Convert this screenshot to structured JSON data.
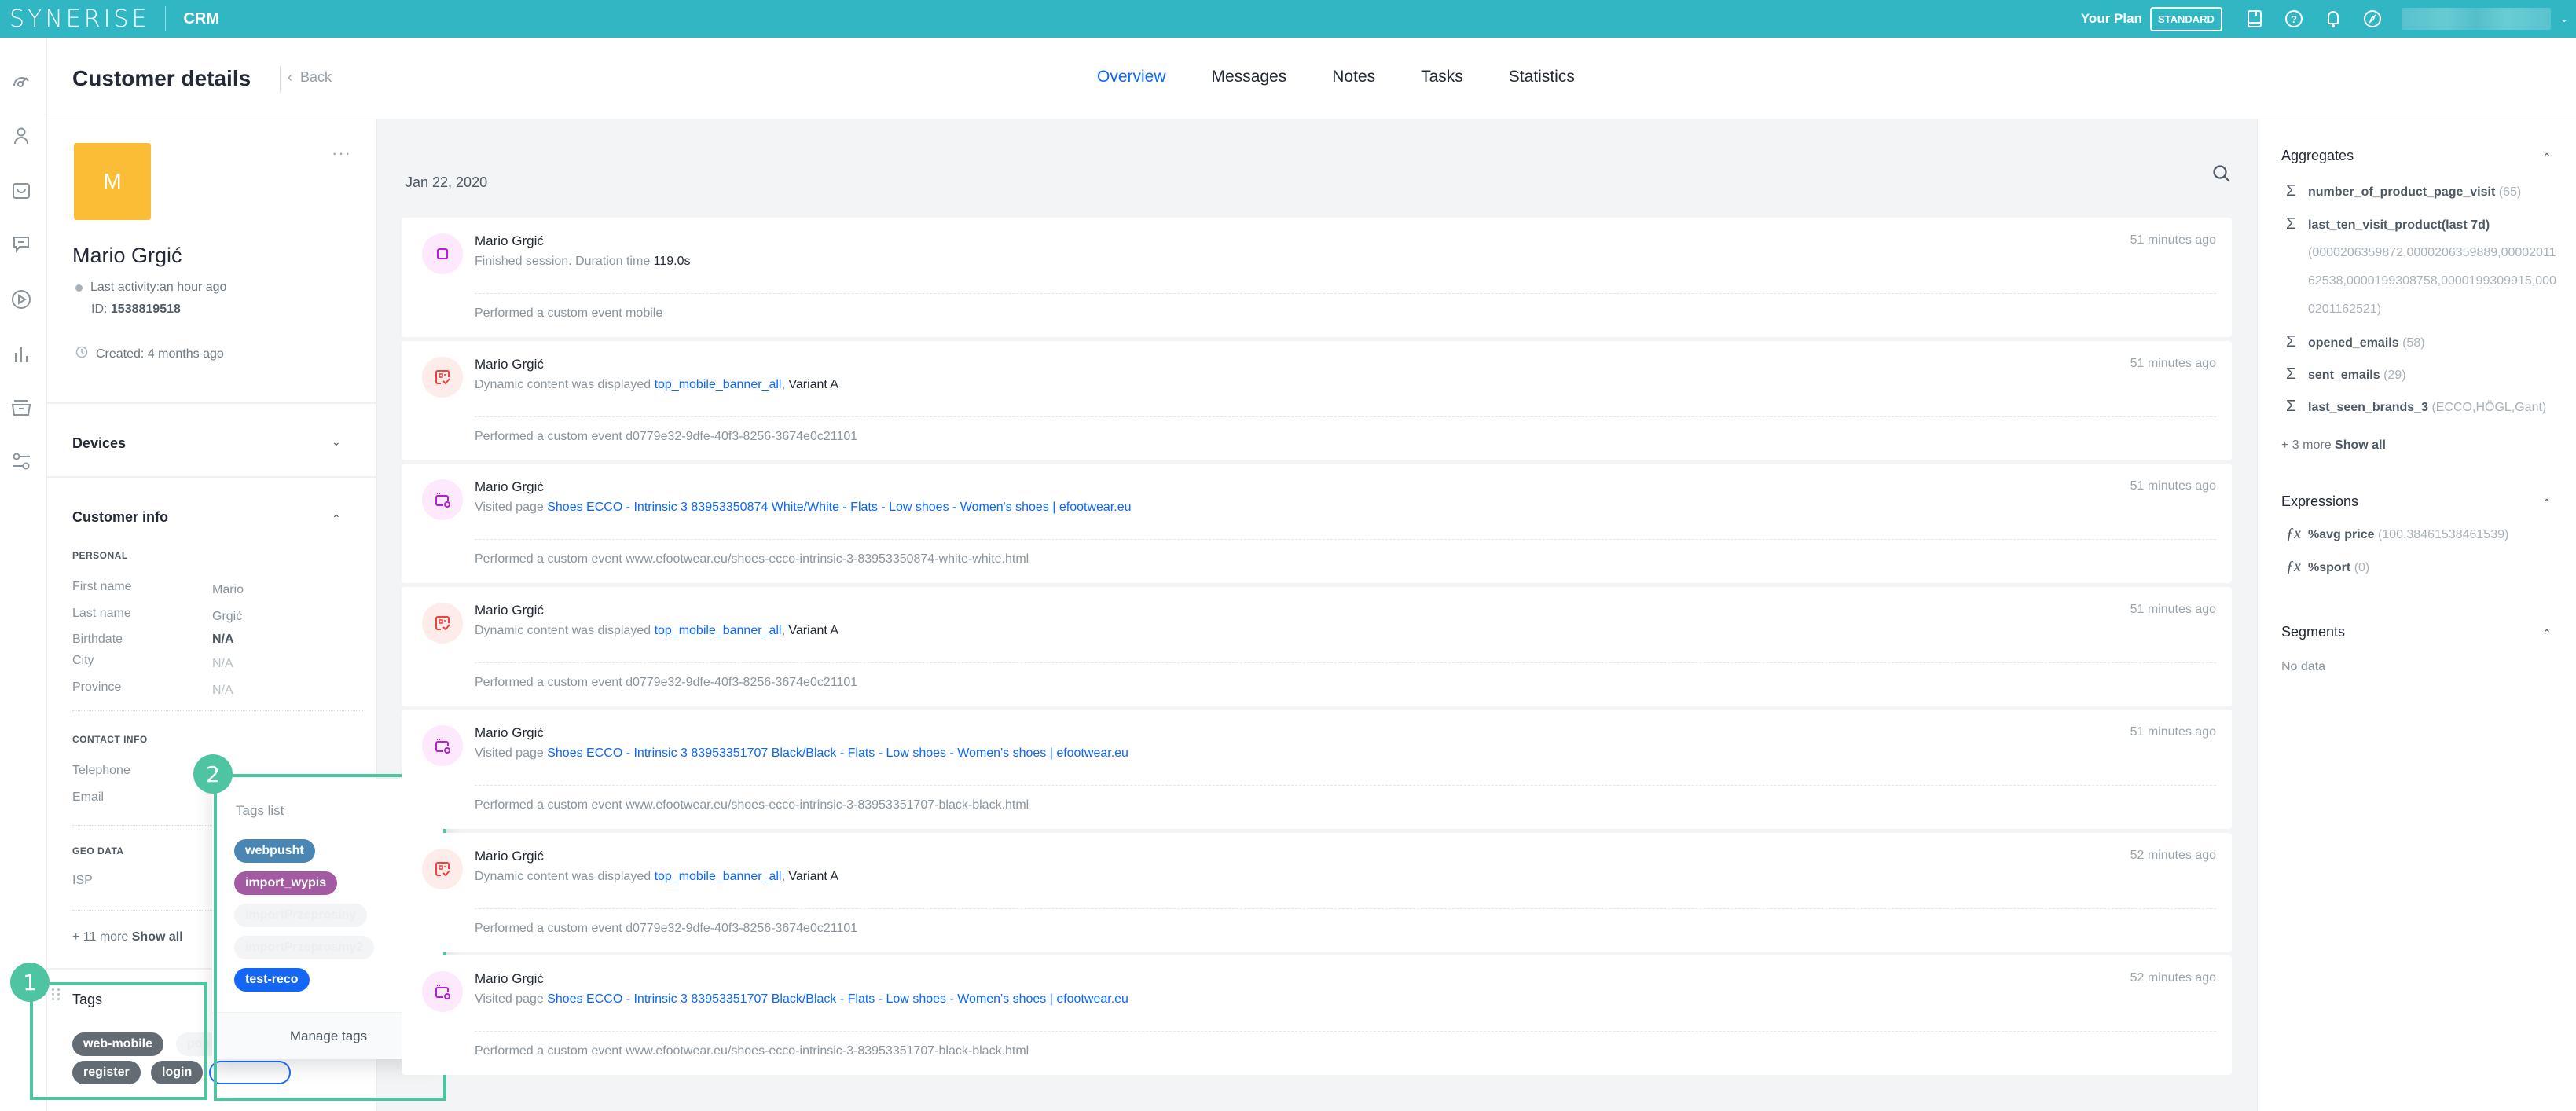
{
  "topbar": {
    "logo": "SYNERISE",
    "app_name": "CRM",
    "plan_label": "Your Plan",
    "plan_badge": "STANDARD",
    "icons": [
      "book-icon",
      "help-icon",
      "bell-icon",
      "compass-icon"
    ]
  },
  "rail": {
    "items": [
      "dashboard-icon",
      "profile-icon",
      "bag-icon",
      "chat-icon",
      "play-icon",
      "analytics-icon",
      "inbox-icon",
      "settings-sliders-icon"
    ]
  },
  "header": {
    "title": "Customer details",
    "back_label": "Back",
    "tabs": [
      {
        "label": "Overview",
        "active": true
      },
      {
        "label": "Messages",
        "active": false
      },
      {
        "label": "Notes",
        "active": false
      },
      {
        "label": "Tasks",
        "active": false
      },
      {
        "label": "Statistics",
        "active": false
      }
    ]
  },
  "customer": {
    "avatar_initial": "M",
    "avatar_color": "#fbbd36",
    "name": "Mario Grgić",
    "last_activity": "Last activity:an hour ago",
    "id_label": "ID:",
    "id_value": "1538819518",
    "created": "Created: 4 months ago",
    "more_menu": "···"
  },
  "devices": {
    "title": "Devices"
  },
  "customer_info": {
    "title": "Customer info",
    "personal": {
      "label": "PERSONAL",
      "fields": [
        {
          "label": "First name",
          "value": "Mario"
        },
        {
          "label": "Last name",
          "value": "Grgić"
        },
        {
          "label": "Birthdate",
          "value": "N/A"
        },
        {
          "label": "City",
          "value": "N/A"
        },
        {
          "label": "Province",
          "value": "N/A"
        }
      ]
    },
    "contact": {
      "label": "CONTACT INFO",
      "fields": [
        {
          "label": "Telephone",
          "value": ""
        },
        {
          "label": "Email",
          "value": ""
        }
      ]
    },
    "geo": {
      "label": "GEO DATA",
      "fields": [
        {
          "label": "ISP",
          "value": ""
        }
      ]
    },
    "more_prefix": "+ 11 more",
    "show_all": "Show all"
  },
  "tags": {
    "title": "Tags",
    "assigned": [
      "web-mobile",
      "pop",
      "register",
      "login"
    ],
    "input_value": ""
  },
  "tags_popup": {
    "title": "Tags list",
    "tags": [
      {
        "label": "webpusht",
        "color": "#4a86b4"
      },
      {
        "label": "import_wypis",
        "color": "#a35aa3"
      },
      {
        "label": "importPrzeprosiny",
        "color": "#f3f4f5"
      },
      {
        "label": "importPrzeprosiny2",
        "color": "#f3f4f5"
      },
      {
        "label": "test-reco",
        "color": "#1466f6"
      }
    ],
    "footer": "Manage tags"
  },
  "annotations": [
    {
      "number": "1"
    },
    {
      "number": "2"
    }
  ],
  "feed": {
    "date": "Jan 22, 2020",
    "events": [
      {
        "icon": "session-icon",
        "author": "Mario Grgić",
        "desc_prefix": "Finished session. Duration time ",
        "desc_link": "",
        "desc_strong": "119.0s",
        "time": "51 minutes ago",
        "event": "Performed a custom event mobile"
      },
      {
        "icon": "dynamic-content-icon",
        "author": "Mario Grgić",
        "desc_prefix": "Dynamic content was displayed ",
        "desc_link": "top_mobile_banner_all",
        "desc_strong": ", Variant A",
        "time": "51 minutes ago",
        "event": "Performed a custom event d0779e32-9dfe-40f3-8256-3674e0c21101"
      },
      {
        "icon": "page-visit-icon",
        "author": "Mario Grgić",
        "desc_prefix": "Visited page ",
        "desc_link": "Shoes ECCO - Intrinsic 3 83953350874 White/White - Flats - Low shoes - Women's shoes | efootwear.eu",
        "desc_strong": "",
        "time": "51 minutes ago",
        "event": "Performed a custom event www.efootwear.eu/shoes-ecco-intrinsic-3-83953350874-white-white.html"
      },
      {
        "icon": "dynamic-content-icon",
        "author": "Mario Grgić",
        "desc_prefix": "Dynamic content was displayed ",
        "desc_link": "top_mobile_banner_all",
        "desc_strong": ", Variant A",
        "time": "51 minutes ago",
        "event": "Performed a custom event d0779e32-9dfe-40f3-8256-3674e0c21101"
      },
      {
        "icon": "page-visit-icon",
        "author": "Mario Grgić",
        "desc_prefix": "Visited page ",
        "desc_link": "Shoes ECCO - Intrinsic 3 83953351707 Black/Black - Flats - Low shoes - Women's shoes | efootwear.eu",
        "desc_strong": "",
        "time": "51 minutes ago",
        "event": "Performed a custom event www.efootwear.eu/shoes-ecco-intrinsic-3-83953351707-black-black.html"
      },
      {
        "icon": "dynamic-content-icon",
        "author": "Mario Grgić",
        "desc_prefix": "Dynamic content was displayed ",
        "desc_link": "top_mobile_banner_all",
        "desc_strong": ", Variant A",
        "time": "52 minutes ago",
        "event": "Performed a custom event d0779e32-9dfe-40f3-8256-3674e0c21101"
      },
      {
        "icon": "page-visit-icon",
        "author": "Mario Grgić",
        "desc_prefix": "Visited page ",
        "desc_link": "Shoes ECCO - Intrinsic 3 83953351707 Black/Black - Flats - Low shoes - Women's shoes | efootwear.eu",
        "desc_strong": "",
        "time": "52 minutes ago",
        "event": "Performed a custom event www.efootwear.eu/shoes-ecco-intrinsic-3-83953351707-black-black.html"
      }
    ]
  },
  "aggregates": {
    "title": "Aggregates",
    "items": [
      {
        "name": "number_of_product_page_visit",
        "value": "(65)"
      },
      {
        "name": "last_ten_visit_product(last 7d)",
        "value": ""
      },
      {
        "name": "opened_emails",
        "value": "(58)"
      },
      {
        "name": "sent_emails",
        "value": "(29)"
      },
      {
        "name": "last_seen_brands_3",
        "value": "(ECCO,HÖGL,Gant)"
      }
    ],
    "list_value": "(0000206359872,0000206359889,0000201162538,0000199308758,0000199309915,0000201162521)",
    "more_prefix": "+ 3 more",
    "show_all": "Show all"
  },
  "expressions": {
    "title": "Expressions",
    "items": [
      {
        "name": "%avg price",
        "value": "(100.38461538461539)"
      },
      {
        "name": "%sport",
        "value": "(0)"
      }
    ]
  },
  "segments": {
    "title": "Segments",
    "empty": "No data"
  }
}
